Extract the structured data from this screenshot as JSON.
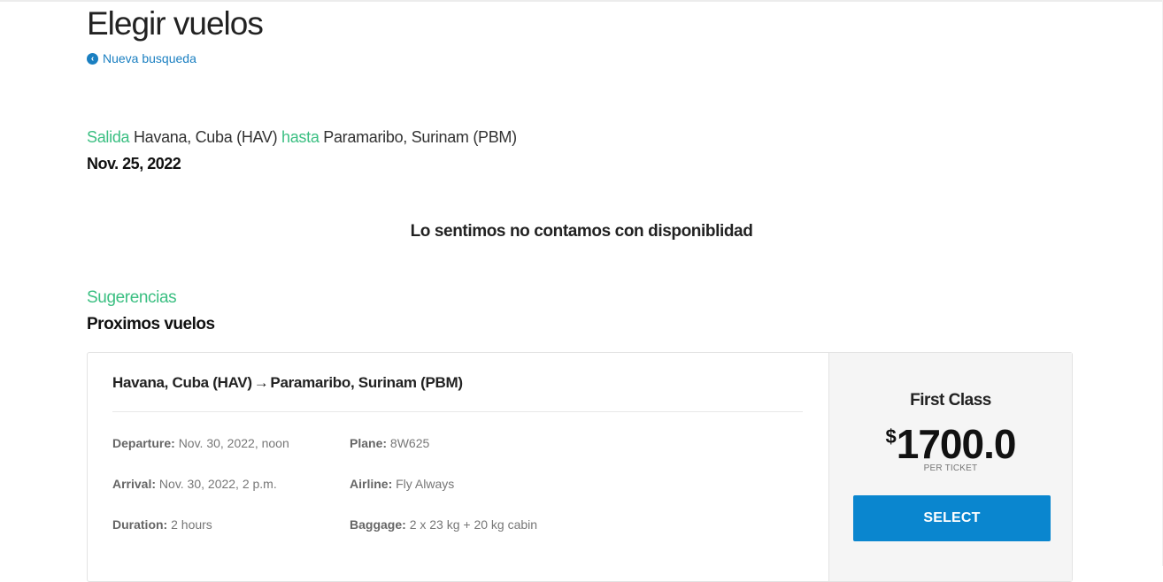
{
  "page": {
    "title": "Elegir vuelos",
    "new_search_label": "Nueva busqueda"
  },
  "search": {
    "departure_word": "Salida",
    "origin": "Havana, Cuba (HAV)",
    "to_word": "hasta",
    "destination": "Paramaribo, Surinam (PBM)",
    "date": "Nov. 25, 2022"
  },
  "availability": {
    "message": "Lo sentimos no contamos con disponiblidad"
  },
  "suggestions": {
    "label": "Sugerencias",
    "heading": "Proximos vuelos"
  },
  "flights": [
    {
      "origin": "Havana, Cuba (HAV)",
      "arrow": "→",
      "destination": "Paramaribo, Surinam (PBM)",
      "departure_label": "Departure:",
      "departure_value": "Nov. 30, 2022, noon",
      "arrival_label": "Arrival:",
      "arrival_value": "Nov. 30, 2022, 2 p.m.",
      "duration_label": "Duration:",
      "duration_value": "2 hours",
      "plane_label": "Plane:",
      "plane_value": "8W625",
      "airline_label": "Airline:",
      "airline_value": "Fly Always",
      "baggage_label": "Baggage:",
      "baggage_value": "2 x 23 kg + 20 kg cabin",
      "class_name": "First Class",
      "currency_symbol": "$",
      "price": "1700.0",
      "price_note": "PER TICKET",
      "select_label": "SELECT"
    }
  ],
  "colors": {
    "accent_green": "#3bbf82",
    "link_blue": "#1a7fc1",
    "button_blue": "#0a86cf"
  },
  "icons": {
    "new_search": "arrow-circle-left-icon",
    "route_arrow": "arrow-right-icon"
  }
}
